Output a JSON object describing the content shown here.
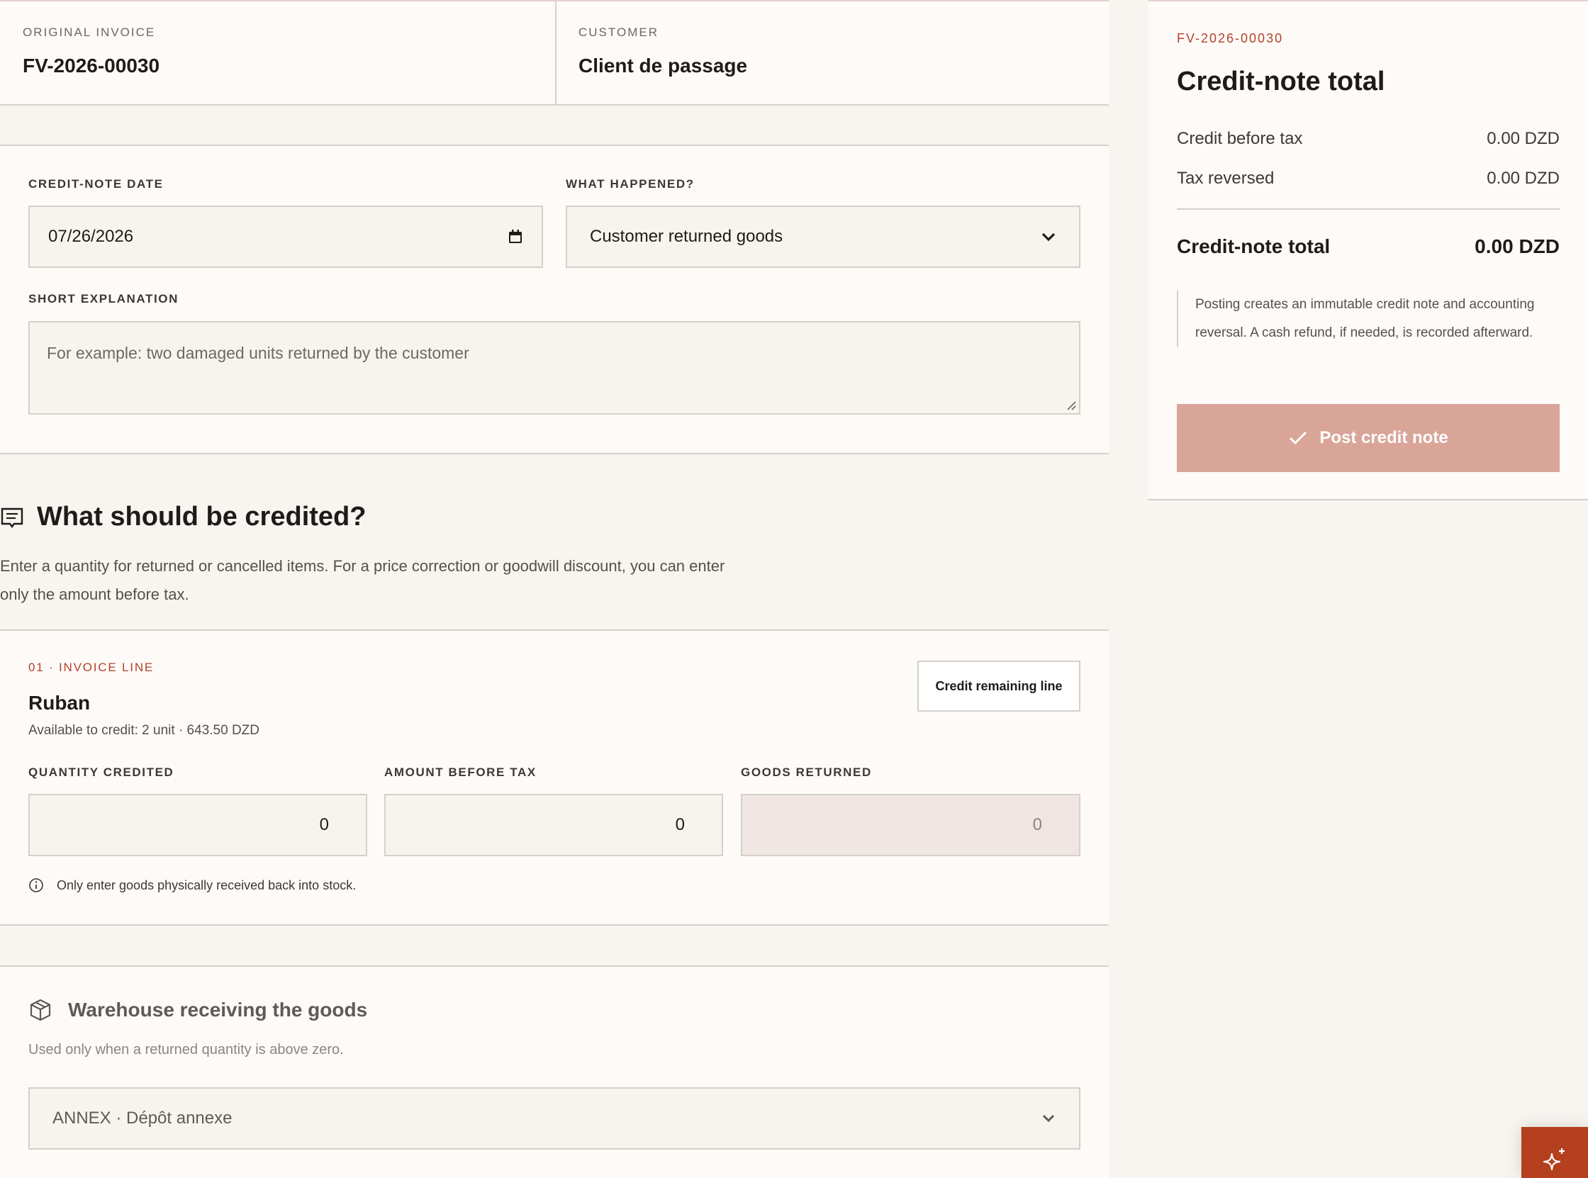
{
  "invoice_info": {
    "original_label": "ORIGINAL INVOICE",
    "original_value": "FV-2026-00030",
    "customer_label": "CUSTOMER",
    "customer_value": "Client de passage"
  },
  "form": {
    "date_label": "CREDIT-NOTE DATE",
    "date_value": "07/26/2026",
    "reason_label": "WHAT HAPPENED?",
    "reason_value": "Customer returned goods",
    "explanation_label": "SHORT EXPLANATION",
    "explanation_placeholder": "For example: two damaged units returned by the customer"
  },
  "credit_section": {
    "title": "What should be credited?",
    "description": "Enter a quantity for returned or cancelled items. For a price correction or goodwill discount, you can enter only the amount before tax."
  },
  "line": {
    "kicker": "01 · INVOICE LINE",
    "name": "Ruban",
    "available": "Available to credit: 2 unit · 643.50 DZD",
    "credit_remaining_label": "Credit remaining line",
    "qty_label": "QUANTITY CREDITED",
    "qty_value": "0",
    "amount_label": "AMOUNT BEFORE TAX",
    "amount_value": "0",
    "returned_label": "GOODS RETURNED",
    "returned_value": "0",
    "hint": "Only enter goods physically received back into stock."
  },
  "warehouse": {
    "title": "Warehouse receiving the goods",
    "description": "Used only when a returned quantity is above zero.",
    "selected": "ANNEX · Dépôt annexe"
  },
  "summary": {
    "kicker": "FV-2026-00030",
    "title": "Credit-note total",
    "before_tax_label": "Credit before tax",
    "before_tax_value": "0.00 DZD",
    "tax_label": "Tax reversed",
    "tax_value": "0.00 DZD",
    "total_label": "Credit-note total",
    "total_value": "0.00 DZD",
    "note": "Posting creates an immutable credit note and accounting reversal. A cash refund, if needed, is recorded afterward.",
    "post_button": "Post credit note"
  },
  "icons": {
    "section_icon": "receipt-icon",
    "warehouse_icon": "package-icon",
    "info_icon": "info-icon",
    "check_icon": "check-icon",
    "fab_icon": "sparkles-icon"
  },
  "colors": {
    "accent": "#b4412b",
    "post_button_disabled": "#d9a598",
    "background": "#f7f5f0",
    "card": "#fdfaf8"
  }
}
